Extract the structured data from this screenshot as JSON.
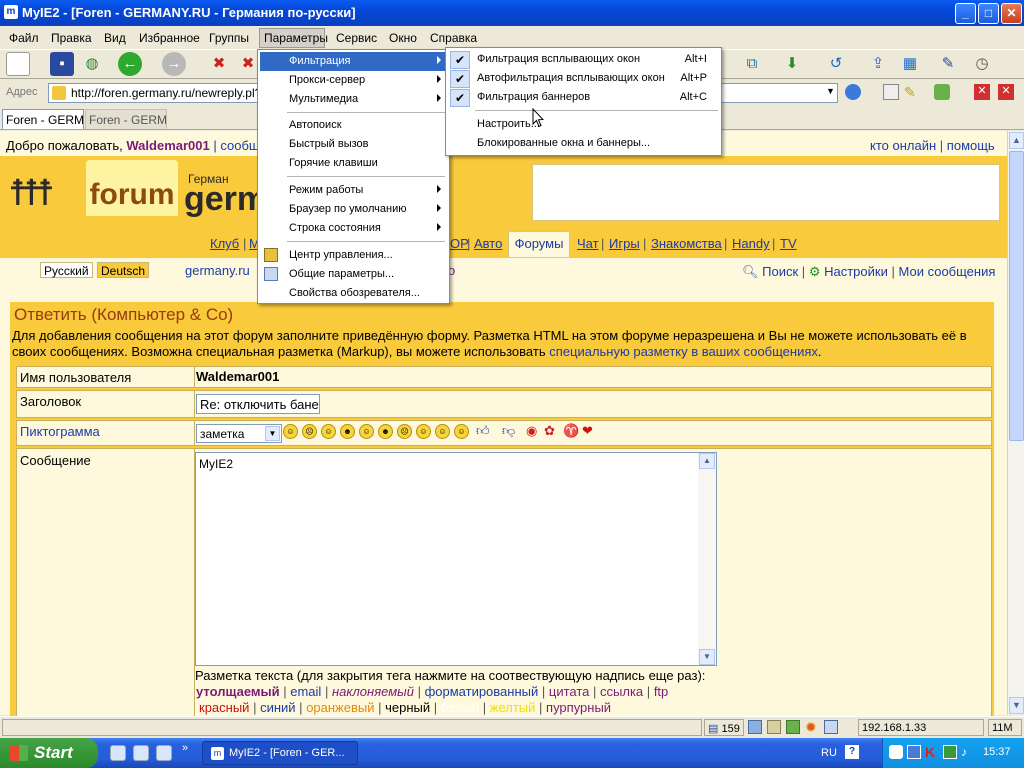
{
  "window": {
    "title": "MyIE2 - [Foren - GERMANY.RU - Германия по-русски]",
    "app_icon": "myie2-icon",
    "min": "_",
    "max": "□",
    "close": "✕"
  },
  "menubar": [
    "Файл",
    "Правка",
    "Вид",
    "Избранное",
    "Группы",
    "Параметры",
    "Сервис",
    "Окно",
    "Справка"
  ],
  "address": {
    "label": "Адрес",
    "url": "http://foren.germany.ru/newreply.pl?"
  },
  "tabs": [
    "Foren - GERM...",
    "Foren - GERM..."
  ],
  "page": {
    "welcome_prefix": "Добро пожаловать,",
    "username": "Waldemar001",
    "welcome_sep": "|",
    "welcome_link": "сообщ",
    "top_links": [
      "кто онлайн",
      "помощь"
    ],
    "logo_forum": "forum",
    "logo_small": "Герман",
    "logo_big": "germa",
    "nav": [
      "Клуб",
      "М",
      "ОР",
      "Авто",
      "Форумы",
      "Чат",
      "Игры",
      "Знакомства",
      "Handy",
      "TV"
    ],
    "lang": [
      "Русский",
      "Deutsch"
    ],
    "site_link": "germany.ru",
    "site_link_tail": "о",
    "right_links": [
      "Поиск",
      "Настройки",
      "Мои сообщения"
    ],
    "reply_title": "Ответить (Компьютер & Co)",
    "info": "Для добавления сообщения на этот форум заполните приведённую форму. Разметка HTML на этом форуме неразрешена и Вы не можете использовать её в своих сообщениях. Возможна специальная разметка (Markup), вы можете использовать",
    "info_link": "специальную разметку в ваших сообщениях",
    "info_end": ".",
    "form": {
      "user_label": "Имя пользователя",
      "user_value": "Waldemar001",
      "subject_label": "Заголовок",
      "subject_value": "Re: отключить банер",
      "icon_label": "Пиктограмма",
      "icon_select": "заметка",
      "message_label": "Сообщение",
      "message_value": "MyIE2"
    },
    "markup_label": "Разметка текста (для закрытия тега нажмите на соотвествующую надпись еще раз):",
    "markup_row1": [
      "утолщаемый",
      "email",
      "наклоняемый",
      "форматированный",
      "цитата",
      "ссылка",
      "ftp"
    ],
    "markup_row2": [
      "красный",
      "синий",
      "оранжевый",
      "черный",
      "белый",
      "желтый",
      "пурпурный"
    ]
  },
  "menus": {
    "params": [
      {
        "label": "Фильтрация",
        "sub": true
      },
      {
        "label": "Прокси-сервер",
        "sub": true
      },
      {
        "label": "Мультимедиа",
        "sub": true
      },
      {
        "label": "Автопоиск"
      },
      {
        "label": "Быстрый вызов"
      },
      {
        "label": "Горячие клавиши"
      },
      {
        "label": "Режим работы",
        "sub": true
      },
      {
        "label": "Браузер по умолчанию",
        "sub": true
      },
      {
        "label": "Строка состояния",
        "sub": true
      },
      {
        "label": "Центр управления..."
      },
      {
        "label": "Общие параметры..."
      },
      {
        "label": "Свойства обозревателя..."
      }
    ],
    "filter": [
      {
        "label": "Фильтрация всплывающих окон",
        "shortcut": "Alt+I",
        "checked": true
      },
      {
        "label": "Автофильтрация всплывающих окон",
        "shortcut": "Alt+P",
        "checked": true
      },
      {
        "label": "Фильтрация баннеров",
        "shortcut": "Alt+C",
        "checked": true
      },
      {
        "label": "Настроить..."
      },
      {
        "label": "Блокированные окна и баннеры..."
      }
    ],
    "check": "✔"
  },
  "statusbar": {
    "count": "159",
    "ip": "192.168.1.33",
    "mem": "11M"
  },
  "taskbar": {
    "start": "Start",
    "task": "MyIE2 - [Foren - GER...",
    "lang": "RU",
    "time": "15:37"
  },
  "colors": {
    "banner": "#f8ca3c",
    "page_bg": "#fef9dc",
    "highlight": "#316ac5",
    "link": "#1b3aa8",
    "title": "#9a3a10"
  }
}
